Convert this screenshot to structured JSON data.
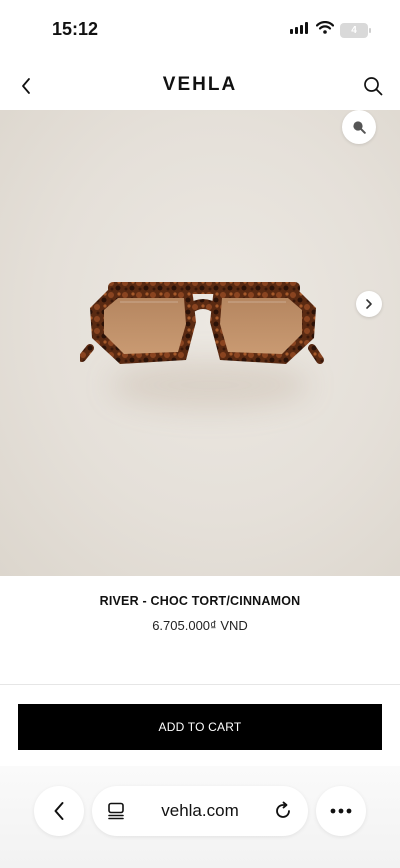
{
  "status_bar": {
    "time": "15:12",
    "battery_label": "4",
    "icons": [
      "signal-icon",
      "wifi-icon",
      "battery-icon"
    ]
  },
  "nav": {
    "brand": "VEHLA",
    "back_icon": "chevron-left-icon",
    "search_icon": "search-icon"
  },
  "gallery": {
    "image_description": "tortoiseshell aviator sunglasses with brown lenses",
    "zoom_icon": "magnifier-icon",
    "next_icon": "chevron-right-icon"
  },
  "product": {
    "name": "RIVER - CHOC TORT/CINNAMON",
    "price": "6.705.000₫ VND"
  },
  "actions": {
    "add_to_cart_label": "ADD TO CART"
  },
  "browser": {
    "url": "vehla.com",
    "icons": [
      "back-icon",
      "reader-icon",
      "reload-icon",
      "more-icon"
    ]
  },
  "colors": {
    "button_bg": "#000000",
    "button_text": "#ffffff",
    "hero_bg": "#e6e1da"
  }
}
